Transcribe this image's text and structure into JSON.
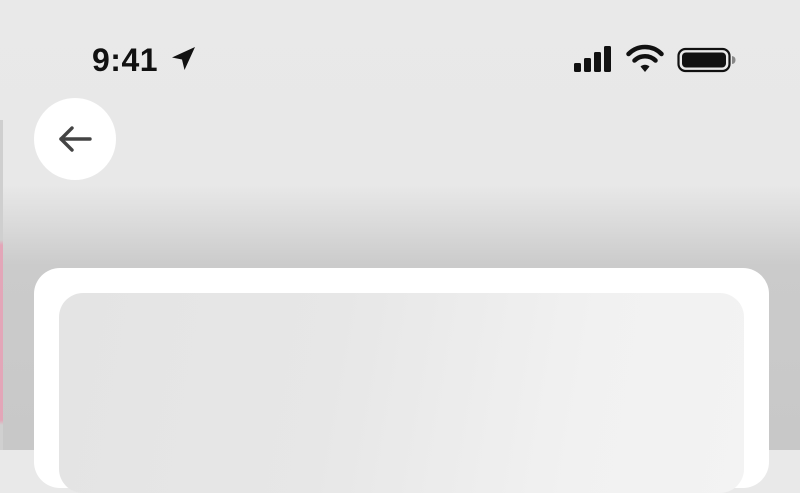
{
  "status_bar": {
    "time": "9:41",
    "icons": {
      "location": "location-arrow-icon",
      "signal": "cellular-signal-icon",
      "wifi": "wifi-icon",
      "battery": "battery-full-icon"
    }
  },
  "navigation": {
    "back_icon": "arrow-left-icon"
  },
  "colors": {
    "background": "#e9e9e9",
    "card": "#ffffff",
    "placeholder": "#e6e6e6",
    "icon": "#111111",
    "back_arrow": "#444444"
  }
}
